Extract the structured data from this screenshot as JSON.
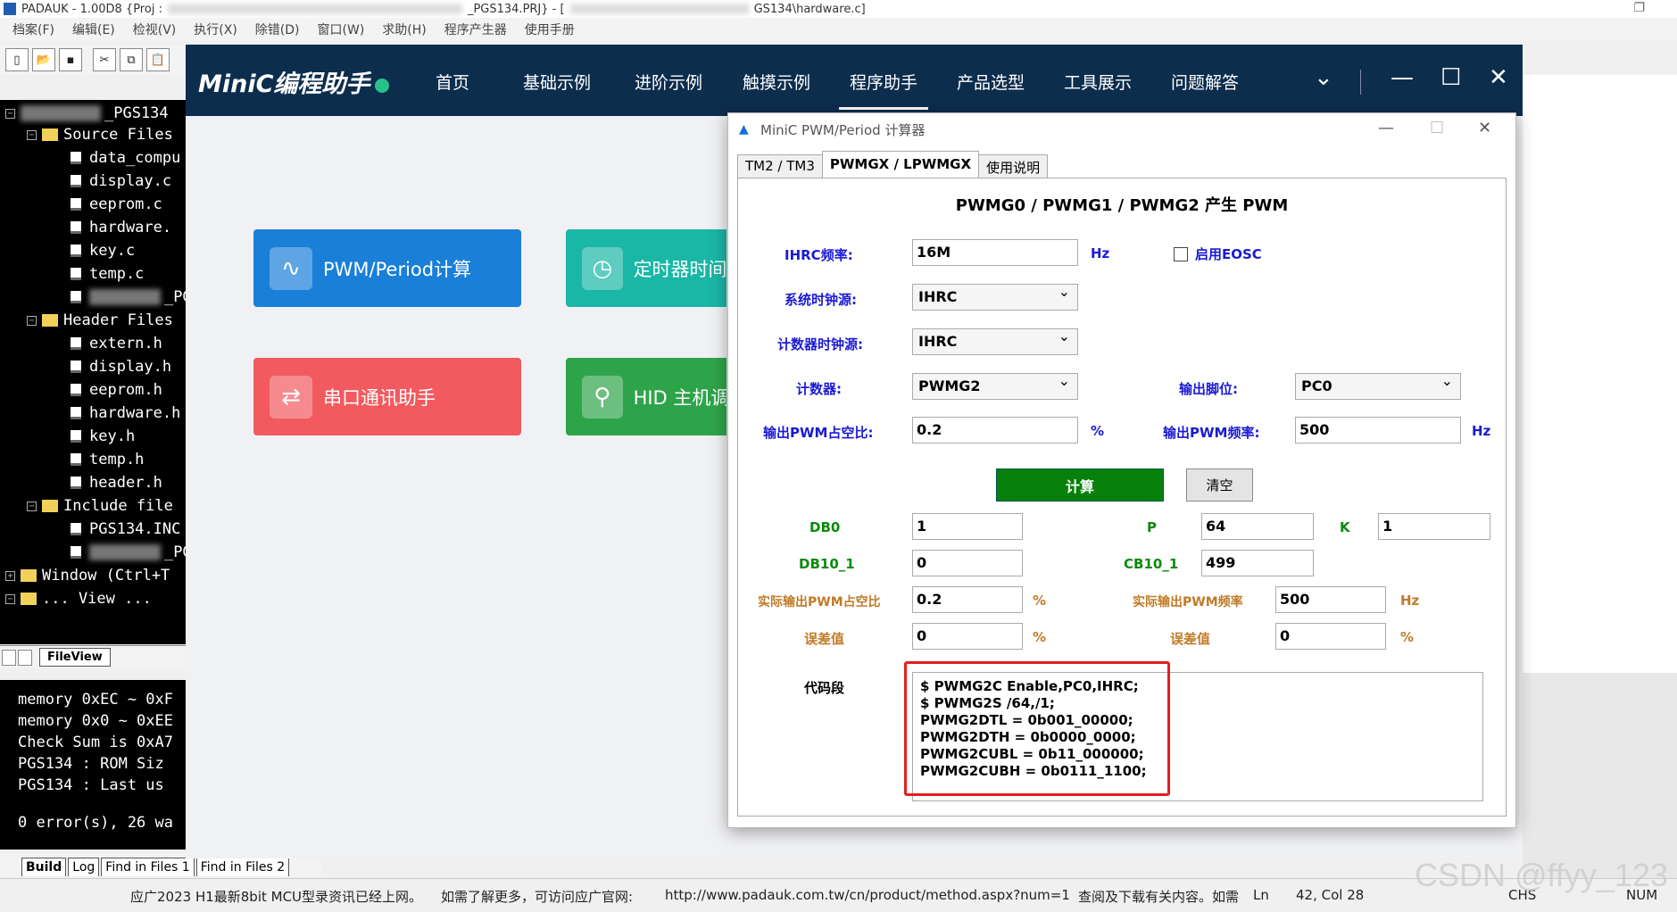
{
  "ide": {
    "title": "PADAUK - 1.00D8 {Proj :",
    "title_mid": "_PGS134.PRJ} - [",
    "title_end": "GS134\\hardware.c]",
    "menu": [
      "档案(F)",
      "编辑(E)",
      "检视(V)",
      "执行(X)",
      "除错(D)",
      "窗口(W)",
      "求助(H)",
      "程序产生器",
      "使用手册"
    ],
    "toolbar_icons": [
      "new-file-icon",
      "open-folder-icon",
      "save-icon",
      "cut-icon",
      "copy-icon",
      "paste-icon"
    ],
    "tree": {
      "root": "_PGS134",
      "source_folder": "Source Files",
      "source_files": [
        "data_compu",
        "display.c",
        "eeprom.c",
        "hardware.",
        "key.c",
        "temp.c",
        "_PG"
      ],
      "header_folder": "Header Files",
      "header_files": [
        "extern.h",
        "display.h",
        "eeprom.h",
        "hardware.h",
        "key.h",
        "temp.h",
        "header.h"
      ],
      "include_folder": "Include file",
      "include_files": [
        "PGS134.INC",
        "_PG"
      ],
      "window_item": "Window (Ctrl+T",
      "view_item": "... View ..."
    },
    "tree_tab": "FileView",
    "output_lines": [
      "memory 0xEC ~ 0xF",
      "memory 0x0 ~ 0xEE",
      "Check Sum is 0xA7",
      "PGS134  : ROM Siz",
      "PGS134  : Last us",
      "0 error(s), 26 wa"
    ],
    "output_tabs": [
      "Build",
      "Log",
      "Find in Files 1",
      "Find in Files 2"
    ],
    "status": {
      "msg1": "应广2023 H1最新8bit MCU型录资讯已经上网。",
      "msg2": "如需了解更多，可访问应广官网:",
      "url": "http://www.padauk.com.tw/cn/product/method.aspx?num=1",
      "msg3": "查阅及下载有关内容。如需",
      "ln": "Ln",
      "pos": "42, Col 28",
      "chs": "CHS",
      "num": "NUM"
    },
    "watermark": "CSDN @ffyy_123"
  },
  "minic": {
    "logo": "MiniC编程助手",
    "nav": [
      "首页",
      "基础示例",
      "进阶示例",
      "触摸示例",
      "程序助手",
      "产品选型",
      "工具展示",
      "问题解答"
    ],
    "active_nav": "程序助手",
    "cards": [
      {
        "label": "PWM/Period计算",
        "color": "#1a7fd8",
        "icon": "waveform-icon"
      },
      {
        "label": "定时器时间计",
        "color": "#1ab7a6",
        "icon": "clock-icon"
      },
      {
        "label": "串口通讯助手",
        "color": "#f25a5f",
        "icon": "serial-port-icon"
      },
      {
        "label": "HID 主机调",
        "color": "#2ea44a",
        "icon": "usb-icon"
      }
    ]
  },
  "dialog": {
    "title": "MiniC PWM/Period 计算器",
    "tabs": [
      "TM2 / TM3",
      "PWMGX / LPWMGX",
      "使用说明"
    ],
    "selected_tab": "PWMGX / LPWMGX",
    "heading": "PWMG0 / PWMG1 / PWMG2 产生 PWM",
    "ihrc_label": "IHRC频率:",
    "ihrc_value": "16M",
    "hz": "Hz",
    "eosc_label": "启用EOSC",
    "sysclk_label": "系统时钟源:",
    "sysclk_value": "IHRC",
    "cntclk_label": "计数器时钟源:",
    "cntclk_value": "IHRC",
    "counter_label": "计数器:",
    "counter_value": "PWMG2",
    "outpin_label": "输出脚位:",
    "outpin_value": "PC0",
    "duty_label": "输出PWM占空比:",
    "duty_value": "0.2",
    "pct": "%",
    "freq_label": "输出PWM频率:",
    "freq_value": "500",
    "calc_button": "计算",
    "clear_button": "清空",
    "db0_label": "DB0",
    "db0_value": "1",
    "p_label": "P",
    "p_value": "64",
    "k_label": "K",
    "k_value": "1",
    "db10_label": "DB10_1",
    "db10_value": "0",
    "cb10_label": "CB10_1",
    "cb10_value": "499",
    "actual_duty_label": "实际输出PWM占空比",
    "actual_duty_value": "0.2",
    "actual_freq_label": "实际输出PWM频率",
    "actual_freq_value": "500",
    "err_label": "误差值",
    "err_duty_value": "0",
    "err_freq_value": "0",
    "code_label": "代码段",
    "code_lines": [
      "$ PWMG2C Enable,PC0,IHRC;",
      "$ PWMG2S /64,/1;",
      "PWMG2DTL = 0b001_00000;",
      "PWMG2DTH = 0b0000_0000;",
      "PWMG2CUBL = 0b11_000000;",
      "PWMG2CUBH = 0b0111_1100;"
    ]
  }
}
